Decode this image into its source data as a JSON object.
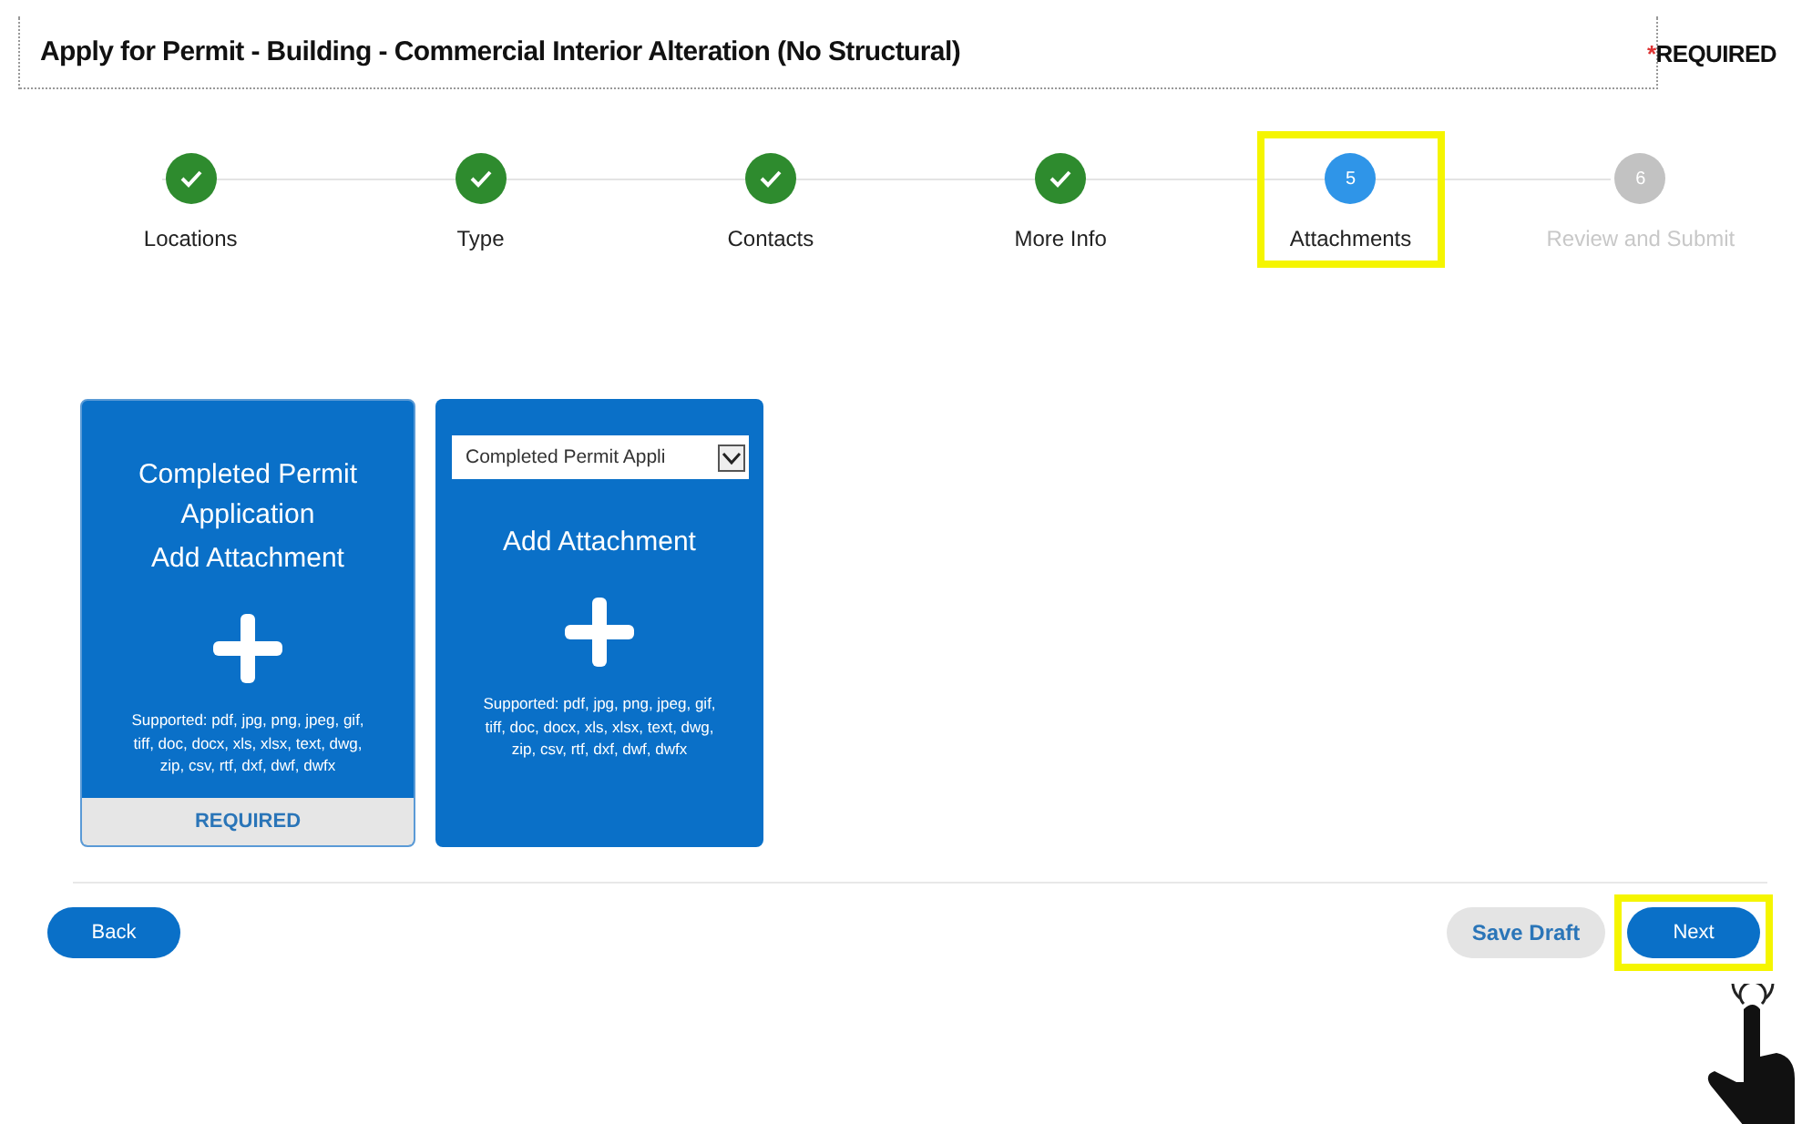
{
  "header": {
    "title": "Apply for Permit - Building - Commercial Interior Alteration (No Structural)",
    "required_mark": "*",
    "required_label": "REQUIRED"
  },
  "steps": [
    {
      "label": "Locations",
      "completed": true,
      "current": false,
      "highlighted": false
    },
    {
      "label": "Type",
      "completed": true,
      "current": false,
      "highlighted": false
    },
    {
      "label": "Contacts",
      "completed": true,
      "current": false,
      "highlighted": false
    },
    {
      "label": "More Info",
      "completed": true,
      "current": false,
      "highlighted": false
    },
    {
      "label": "Attachments",
      "completed": false,
      "current": true,
      "number": "5",
      "highlighted": true
    },
    {
      "label": "Review and Submit",
      "completed": false,
      "current": false,
      "number": "6",
      "highlighted": false
    }
  ],
  "cards": [
    {
      "kind": "fixed",
      "title": "Completed Permit Application",
      "action": "Add Attachment",
      "supported": "Supported: pdf, jpg, png, jpeg, gif, tiff, doc, docx, xls, xlsx, text, dwg, zip, csv, rtf, dxf, dwf, dwfx",
      "footer": "REQUIRED"
    },
    {
      "kind": "select",
      "select_value": "Completed Permit Appli",
      "action": "Add Attachment",
      "supported": "Supported: pdf, jpg, png, jpeg, gif, tiff, doc, docx, xls, xlsx, text, dwg, zip, csv, rtf, dxf, dwf, dwfx"
    }
  ],
  "buttons": {
    "back": "Back",
    "save_draft": "Save Draft",
    "next": "Next",
    "next_highlighted": true
  }
}
